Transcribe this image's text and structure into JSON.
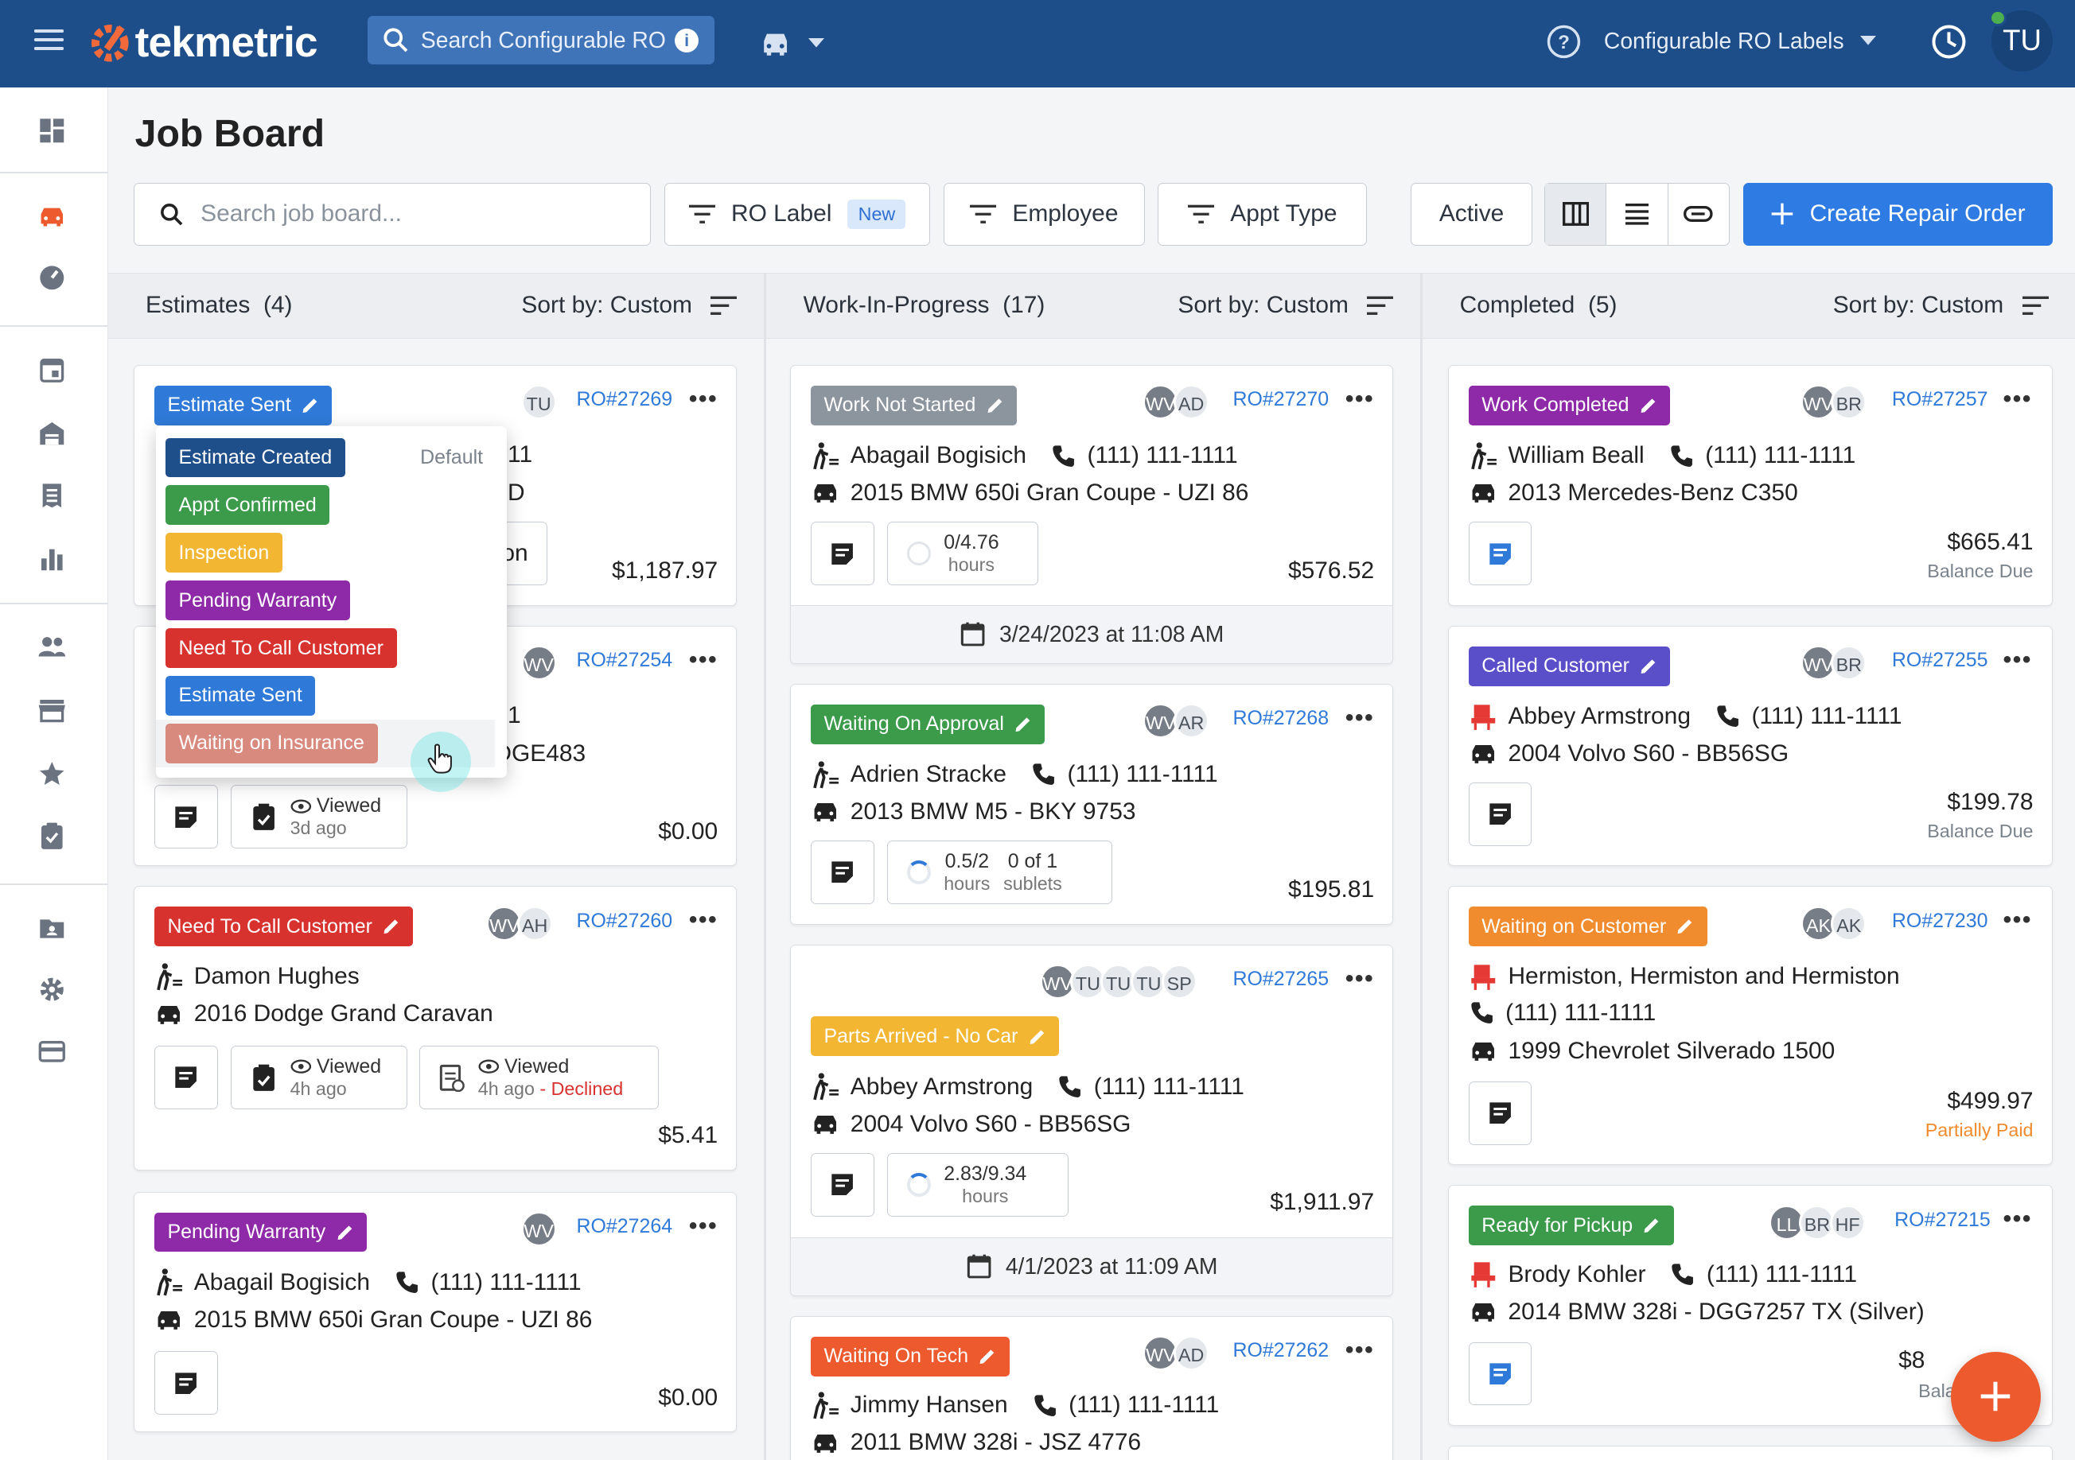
{
  "topbar": {
    "logo_text": "tekmetric",
    "search_placeholder": "Search Configurable RO L",
    "info_glyph": "i",
    "shop_name": "Configurable RO Labels",
    "user_initials": "TU"
  },
  "page": {
    "title": "Job Board"
  },
  "toolbar": {
    "search_placeholder": "Search job board...",
    "ro_label_filter": "RO Label",
    "ro_label_badge": "New",
    "employee_filter": "Employee",
    "appt_type_filter": "Appt Type",
    "status_filter": "Active",
    "create_button": "Create Repair Order"
  },
  "colors": {
    "brand_dark": "#1d4e89",
    "accent_blue": "#2e7be3",
    "fab_orange": "#ec5a2e"
  },
  "columns": {
    "estimates": {
      "title": "Estimates",
      "count": "(4)",
      "sort": "Sort by: Custom"
    },
    "wip": {
      "title": "Work-In-Progress",
      "count": "(17)",
      "sort": "Sort by: Custom"
    },
    "completed": {
      "title": "Completed",
      "count": "(5)",
      "sort": "Sort by: Custom"
    }
  },
  "dropdown": {
    "default_label": "Default",
    "items": [
      "Estimate Created",
      "Appt Confirmed",
      "Inspection",
      "Pending Warranty",
      "Need To Call Customer",
      "Estimate Sent",
      "Waiting on Insurance"
    ]
  },
  "estimates": {
    "c1": {
      "label": "Estimate Sent",
      "avatars": [
        "TU"
      ],
      "ro": "RO#27269",
      "frag_phone": "11",
      "frag_vehicle": "D",
      "frag_btn": "on",
      "price": "$1,187.97"
    },
    "c2": {
      "avatars": [
        "WV"
      ],
      "ro": "RO#27254",
      "frag_phone": "1",
      "frag_vehicle": "DGE483",
      "viewed": "Viewed",
      "viewed_ago": "3d ago",
      "price": "$0.00"
    },
    "c3": {
      "label": "Need To Call Customer",
      "avatars": [
        "WV",
        "AH"
      ],
      "ro": "RO#27260",
      "customer": "Damon Hughes",
      "vehicle": "2016 Dodge Grand Caravan",
      "viewed": "Viewed",
      "viewed_ago": "4h ago",
      "viewed2": "Viewed",
      "viewed2_ago": "4h ago",
      "declined": " - Declined",
      "price": "$5.41"
    },
    "c4": {
      "label": "Pending Warranty",
      "avatars": [
        "WV"
      ],
      "ro": "RO#27264",
      "customer": "Abagail Bogisich",
      "phone": "(111) 111-1111",
      "vehicle": "2015 BMW 650i Gran Coupe - UZI 86",
      "price": "$0.00"
    }
  },
  "wip": {
    "c1": {
      "label": "Work Not Started",
      "avatars": [
        "WV",
        "AD"
      ],
      "ro": "RO#27270",
      "customer": "Abagail Bogisich",
      "phone": "(111) 111-1111",
      "vehicle": "2015 BMW 650i Gran Coupe - UZI 86",
      "hours": "0/4.76",
      "hours_label": "hours",
      "price": "$576.52",
      "date": "3/24/2023 at 11:08 AM"
    },
    "c2": {
      "label": "Waiting On Approval",
      "avatars": [
        "WV",
        "AR"
      ],
      "ro": "RO#27268",
      "customer": "Adrien Stracke",
      "phone": "(111) 111-1111",
      "vehicle": "2013 BMW M5 - BKY 9753",
      "hours": "0.5/2",
      "hours_label": "hours",
      "sublets": "0 of 1",
      "sublets_label": "sublets",
      "price": "$195.81"
    },
    "c3": {
      "label": "Parts Arrived - No Car",
      "avatars": [
        "WV",
        "TU",
        "TU",
        "TU",
        "SP"
      ],
      "ro": "RO#27265",
      "customer": "Abbey Armstrong",
      "phone": "(111) 111-1111",
      "vehicle": "2004 Volvo S60 - BB56SG",
      "hours": "2.83/9.34",
      "hours_label": "hours",
      "price": "$1,911.97",
      "date": "4/1/2023 at 11:09 AM"
    },
    "c4": {
      "label": "Waiting On Tech",
      "avatars": [
        "WV",
        "AD"
      ],
      "ro": "RO#27262",
      "customer": "Jimmy Hansen",
      "phone": "(111) 111-1111",
      "vehicle": "2011 BMW 328i - JSZ 4776"
    }
  },
  "completed": {
    "c1": {
      "label": "Work Completed",
      "avatars": [
        "WV",
        "BR"
      ],
      "ro": "RO#27257",
      "customer": "William Beall",
      "phone": "(111) 111-1111",
      "vehicle": "2013 Mercedes-Benz C350",
      "price": "$665.41",
      "status": "Balance Due"
    },
    "c2": {
      "label": "Called Customer",
      "avatars": [
        "WV",
        "BR"
      ],
      "ro": "RO#27255",
      "customer": "Abbey Armstrong",
      "phone": "(111) 111-1111",
      "vehicle": "2004 Volvo S60 - BB56SG",
      "price": "$199.78",
      "status": "Balance Due"
    },
    "c3": {
      "label": "Waiting on Customer",
      "avatars": [
        "AK",
        "AK"
      ],
      "ro": "RO#27230",
      "customer": "Hermiston, Hermiston and Hermiston",
      "phone": "(111) 111-1111",
      "vehicle": "1999 Chevrolet Silverado 1500",
      "price": "$499.97",
      "status": "Partially Paid"
    },
    "c4": {
      "label": "Ready for Pickup",
      "avatars": [
        "LL",
        "BR",
        "HF"
      ],
      "ro": "RO#27215",
      "customer": "Brody Kohler",
      "phone": "(111) 111-1111",
      "vehicle": "2014 BMW 328i - DGG7257 TX (Silver)",
      "price_partial": "$8",
      "status_partial": "Bala"
    }
  }
}
